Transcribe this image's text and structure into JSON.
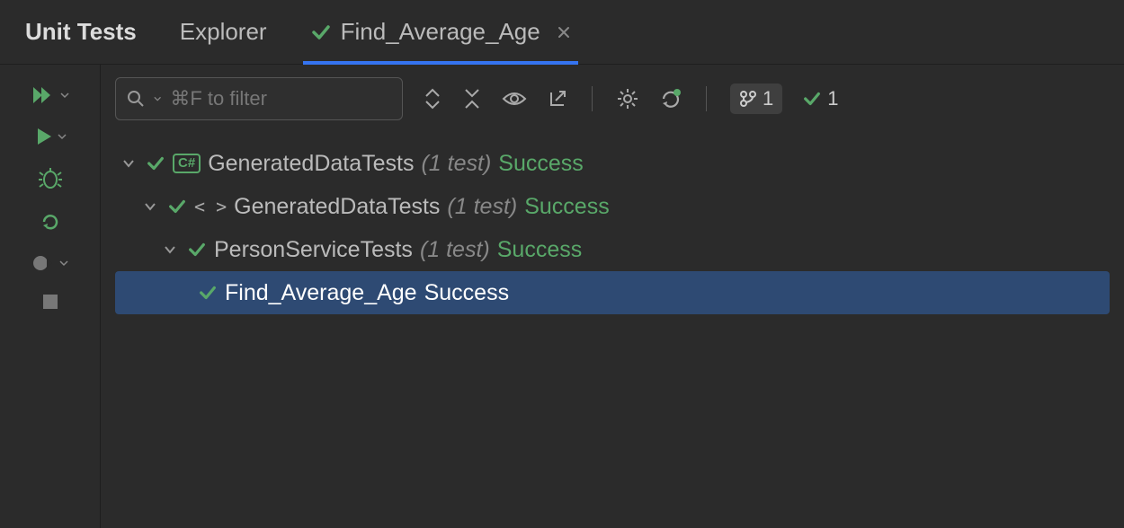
{
  "tabs": {
    "unit_tests": "Unit Tests",
    "explorer": "Explorer",
    "active": "Find_Average_Age"
  },
  "filter": {
    "placeholder": "⌘F to filter"
  },
  "status": {
    "branch_count": "1",
    "pass_count": "1"
  },
  "tree": {
    "n0": {
      "label": "GeneratedDataTests",
      "count": "(1 test)",
      "status": "Success"
    },
    "n1": {
      "label": "GeneratedDataTests",
      "count": "(1 test)",
      "status": "Success"
    },
    "n2": {
      "label": "PersonServiceTests",
      "count": "(1 test)",
      "status": "Success"
    },
    "n3": {
      "label": "Find_Average_Age",
      "status": "Success"
    }
  }
}
